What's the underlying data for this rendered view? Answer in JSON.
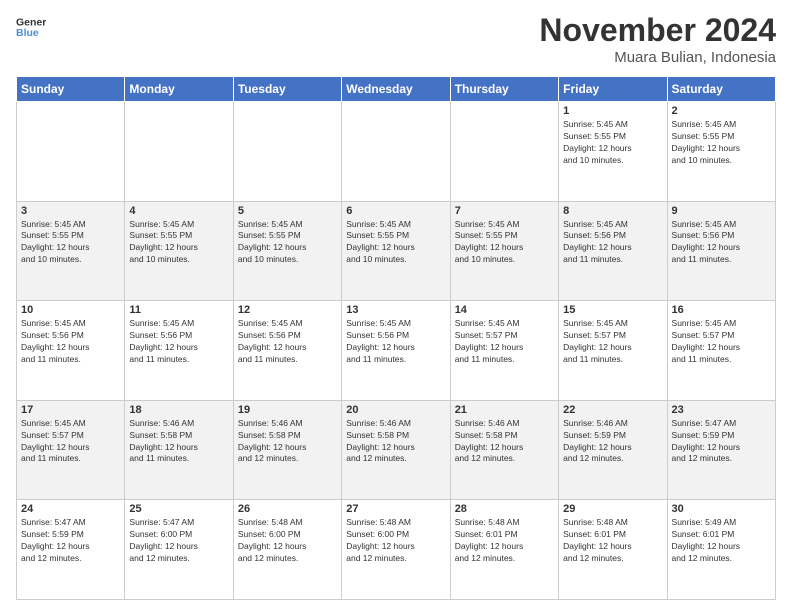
{
  "header": {
    "logo_line1": "General",
    "logo_line2": "Blue",
    "month": "November 2024",
    "location": "Muara Bulian, Indonesia"
  },
  "weekdays": [
    "Sunday",
    "Monday",
    "Tuesday",
    "Wednesday",
    "Thursday",
    "Friday",
    "Saturday"
  ],
  "weeks": [
    [
      {
        "day": "",
        "info": ""
      },
      {
        "day": "",
        "info": ""
      },
      {
        "day": "",
        "info": ""
      },
      {
        "day": "",
        "info": ""
      },
      {
        "day": "",
        "info": ""
      },
      {
        "day": "1",
        "info": "Sunrise: 5:45 AM\nSunset: 5:55 PM\nDaylight: 12 hours\nand 10 minutes."
      },
      {
        "day": "2",
        "info": "Sunrise: 5:45 AM\nSunset: 5:55 PM\nDaylight: 12 hours\nand 10 minutes."
      }
    ],
    [
      {
        "day": "3",
        "info": "Sunrise: 5:45 AM\nSunset: 5:55 PM\nDaylight: 12 hours\nand 10 minutes."
      },
      {
        "day": "4",
        "info": "Sunrise: 5:45 AM\nSunset: 5:55 PM\nDaylight: 12 hours\nand 10 minutes."
      },
      {
        "day": "5",
        "info": "Sunrise: 5:45 AM\nSunset: 5:55 PM\nDaylight: 12 hours\nand 10 minutes."
      },
      {
        "day": "6",
        "info": "Sunrise: 5:45 AM\nSunset: 5:55 PM\nDaylight: 12 hours\nand 10 minutes."
      },
      {
        "day": "7",
        "info": "Sunrise: 5:45 AM\nSunset: 5:55 PM\nDaylight: 12 hours\nand 10 minutes."
      },
      {
        "day": "8",
        "info": "Sunrise: 5:45 AM\nSunset: 5:56 PM\nDaylight: 12 hours\nand 11 minutes."
      },
      {
        "day": "9",
        "info": "Sunrise: 5:45 AM\nSunset: 5:56 PM\nDaylight: 12 hours\nand 11 minutes."
      }
    ],
    [
      {
        "day": "10",
        "info": "Sunrise: 5:45 AM\nSunset: 5:56 PM\nDaylight: 12 hours\nand 11 minutes."
      },
      {
        "day": "11",
        "info": "Sunrise: 5:45 AM\nSunset: 5:56 PM\nDaylight: 12 hours\nand 11 minutes."
      },
      {
        "day": "12",
        "info": "Sunrise: 5:45 AM\nSunset: 5:56 PM\nDaylight: 12 hours\nand 11 minutes."
      },
      {
        "day": "13",
        "info": "Sunrise: 5:45 AM\nSunset: 5:56 PM\nDaylight: 12 hours\nand 11 minutes."
      },
      {
        "day": "14",
        "info": "Sunrise: 5:45 AM\nSunset: 5:57 PM\nDaylight: 12 hours\nand 11 minutes."
      },
      {
        "day": "15",
        "info": "Sunrise: 5:45 AM\nSunset: 5:57 PM\nDaylight: 12 hours\nand 11 minutes."
      },
      {
        "day": "16",
        "info": "Sunrise: 5:45 AM\nSunset: 5:57 PM\nDaylight: 12 hours\nand 11 minutes."
      }
    ],
    [
      {
        "day": "17",
        "info": "Sunrise: 5:45 AM\nSunset: 5:57 PM\nDaylight: 12 hours\nand 11 minutes."
      },
      {
        "day": "18",
        "info": "Sunrise: 5:46 AM\nSunset: 5:58 PM\nDaylight: 12 hours\nand 11 minutes."
      },
      {
        "day": "19",
        "info": "Sunrise: 5:46 AM\nSunset: 5:58 PM\nDaylight: 12 hours\nand 12 minutes."
      },
      {
        "day": "20",
        "info": "Sunrise: 5:46 AM\nSunset: 5:58 PM\nDaylight: 12 hours\nand 12 minutes."
      },
      {
        "day": "21",
        "info": "Sunrise: 5:46 AM\nSunset: 5:58 PM\nDaylight: 12 hours\nand 12 minutes."
      },
      {
        "day": "22",
        "info": "Sunrise: 5:46 AM\nSunset: 5:59 PM\nDaylight: 12 hours\nand 12 minutes."
      },
      {
        "day": "23",
        "info": "Sunrise: 5:47 AM\nSunset: 5:59 PM\nDaylight: 12 hours\nand 12 minutes."
      }
    ],
    [
      {
        "day": "24",
        "info": "Sunrise: 5:47 AM\nSunset: 5:59 PM\nDaylight: 12 hours\nand 12 minutes."
      },
      {
        "day": "25",
        "info": "Sunrise: 5:47 AM\nSunset: 6:00 PM\nDaylight: 12 hours\nand 12 minutes."
      },
      {
        "day": "26",
        "info": "Sunrise: 5:48 AM\nSunset: 6:00 PM\nDaylight: 12 hours\nand 12 minutes."
      },
      {
        "day": "27",
        "info": "Sunrise: 5:48 AM\nSunset: 6:00 PM\nDaylight: 12 hours\nand 12 minutes."
      },
      {
        "day": "28",
        "info": "Sunrise: 5:48 AM\nSunset: 6:01 PM\nDaylight: 12 hours\nand 12 minutes."
      },
      {
        "day": "29",
        "info": "Sunrise: 5:48 AM\nSunset: 6:01 PM\nDaylight: 12 hours\nand 12 minutes."
      },
      {
        "day": "30",
        "info": "Sunrise: 5:49 AM\nSunset: 6:01 PM\nDaylight: 12 hours\nand 12 minutes."
      }
    ]
  ]
}
